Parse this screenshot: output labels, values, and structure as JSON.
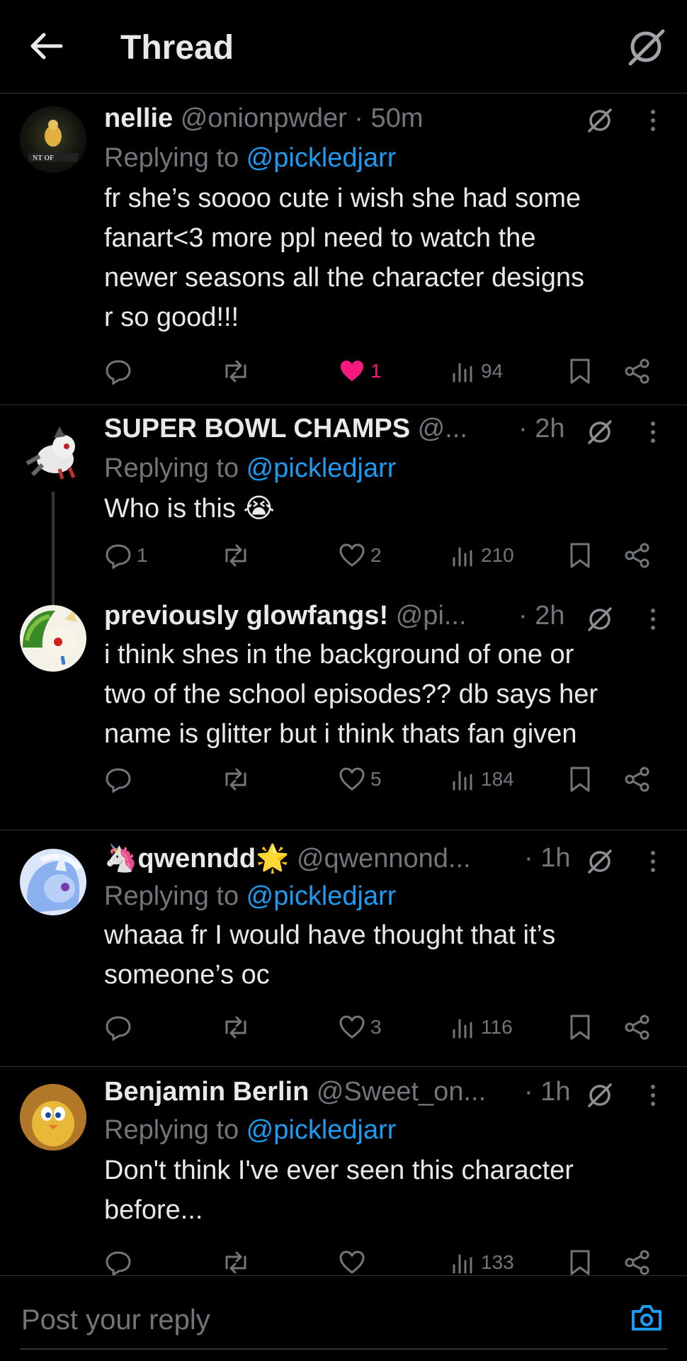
{
  "header": {
    "title": "Thread"
  },
  "replies": [
    {
      "name": "nellie",
      "handle": "@onionpwder",
      "time": "· 50m",
      "replying_prefix": "Replying to ",
      "replying_to": "@pickledjarr",
      "lines": [
        "fr she’s soooo cute i wish she had some",
        "fanart<3 more ppl need to watch the",
        "newer seasons all the character designs",
        "r so good!!!"
      ],
      "counts": {
        "replies": "",
        "reposts": "",
        "likes": "1",
        "views": "94"
      },
      "liked": true
    },
    {
      "name": "SUPER BOWL CHAMPS",
      "handle": "@...",
      "time": "· 2h",
      "replying_prefix": "Replying to ",
      "replying_to": "@pickledjarr",
      "lines": [
        "Who is this 😭"
      ],
      "counts": {
        "replies": "1",
        "reposts": "",
        "likes": "2",
        "views": "210"
      },
      "liked": false
    },
    {
      "name": "previously glowfangs!",
      "handle": "@pi...",
      "time": "· 2h",
      "replying_prefix": "",
      "replying_to": "",
      "lines": [
        "i think shes in the background of one or",
        "two of the school episodes?? db says her",
        "name is glitter but i think thats fan given"
      ],
      "counts": {
        "replies": "",
        "reposts": "",
        "likes": "5",
        "views": "184"
      },
      "liked": false
    },
    {
      "name": "🦄qwenndd🌟",
      "handle": "@qwennond...",
      "time": "· 1h",
      "replying_prefix": "Replying to ",
      "replying_to": "@pickledjarr",
      "lines": [
        "whaaa fr I would have thought that it’s",
        "someone’s oc"
      ],
      "counts": {
        "replies": "",
        "reposts": "",
        "likes": "3",
        "views": "116"
      },
      "liked": false
    },
    {
      "name": "Benjamin Berlin",
      "handle": "@Sweet_on...",
      "time": "· 1h",
      "replying_prefix": "Replying to ",
      "replying_to": "@pickledjarr",
      "lines": [
        "Don't think I've ever seen this character",
        "before..."
      ],
      "counts": {
        "replies": "",
        "reposts": "",
        "likes": "",
        "views": "133"
      },
      "liked": false
    }
  ],
  "composer": {
    "placeholder": "Post your reply"
  },
  "colors": {
    "background": "#000000",
    "accent": "#1d9bf0",
    "like": "#f91880",
    "muted": "#71767b",
    "text": "#e7e9ea",
    "divider": "#2f3336"
  },
  "icons": [
    "back-arrow-icon",
    "grok-icon",
    "more-icon",
    "reply-icon",
    "repost-icon",
    "like-icon",
    "views-icon",
    "bookmark-icon",
    "share-icon",
    "camera-icon"
  ]
}
